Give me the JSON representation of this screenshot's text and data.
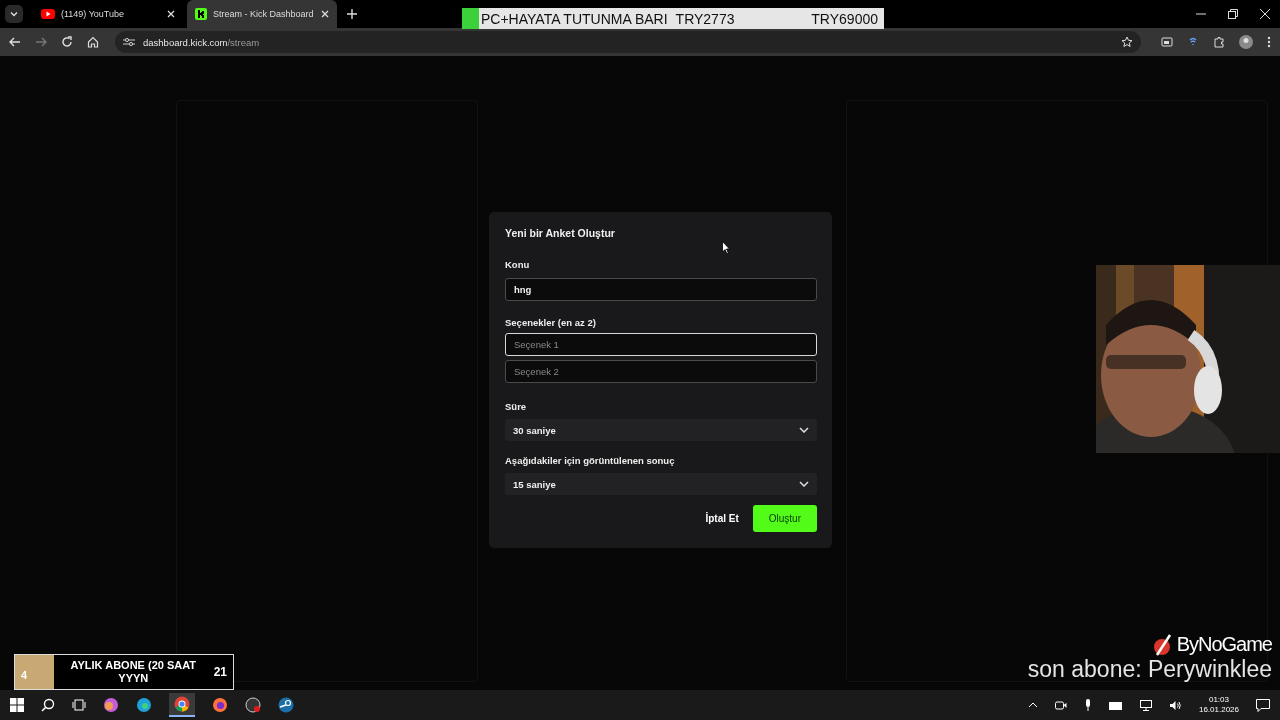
{
  "browser": {
    "tabs": [
      {
        "title": "(1149) YouTube",
        "kind": "youtube",
        "selected": false
      },
      {
        "title": "Stream - Kick Dashboard",
        "kind": "kick",
        "selected": true
      }
    ],
    "address": {
      "host": "dashboard.kick.com",
      "path": "/stream"
    }
  },
  "dialog": {
    "title": "Yeni bir Anket Oluştur",
    "topic": {
      "label": "Konu",
      "value": "hng"
    },
    "options": {
      "label": "Seçenekler (en az 2)",
      "fields": [
        {
          "placeholder": "Seçenek 1",
          "focused": true
        },
        {
          "placeholder": "Seçenek 2",
          "focused": false
        }
      ]
    },
    "selects": [
      {
        "label": "Süre",
        "value": "30 saniye"
      },
      {
        "label": "Aşağıdakiler için görüntülenen sonuç",
        "value": "15 saniye"
      }
    ],
    "buttons": [
      {
        "label": "İptal Et",
        "kind": "text"
      },
      {
        "label": "Oluştur",
        "kind": "primary"
      }
    ]
  },
  "goal_bar": {
    "title": "PC+HAYATA TUTUNMA BARI",
    "current": "TRY2773",
    "target": "TRY69000",
    "level": 0.04
  },
  "sub_goal": {
    "current": "4",
    "title": "AYLIK ABONE (20 SAAT YYYN",
    "target": "21",
    "level": 0.18
  },
  "brand": "ByNoGame",
  "last_sub": "son abone: Perywinklee",
  "clock": {
    "time": "01:03",
    "date": "16.01.2026"
  }
}
